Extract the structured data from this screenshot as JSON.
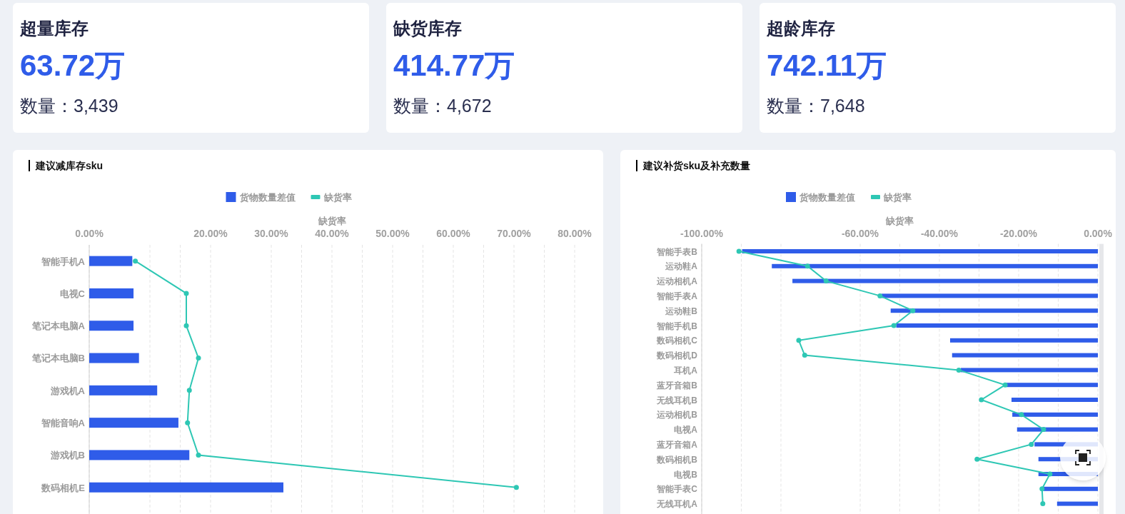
{
  "stats": [
    {
      "title": "超量库存",
      "value": "63.72万",
      "count": "数量：3,439"
    },
    {
      "title": "缺货库存",
      "value": "414.77万",
      "count": "数量：4,672"
    },
    {
      "title": "超龄库存",
      "value": "742.11万",
      "count": "数量：7,648"
    }
  ],
  "panels": [
    {
      "title": "建议减库存sku",
      "chart_data": {
        "type": "bar",
        "orientation": "horizontal",
        "xlabel": "缺货率",
        "xlim": [
          0,
          80
        ],
        "xticks": [
          {
            "value": 0,
            "label": "0.00%"
          },
          {
            "value": 20,
            "label": "20.00%"
          },
          {
            "value": 30,
            "label": "30.00%"
          },
          {
            "value": 40,
            "label": "40.00%"
          },
          {
            "value": 50,
            "label": "50.00%"
          },
          {
            "value": 60,
            "label": "60.00%"
          },
          {
            "value": 70,
            "label": "70.00%"
          },
          {
            "value": 80,
            "label": "80.00%"
          }
        ],
        "grid": true,
        "legend": true,
        "categories": [
          "智能手机A",
          "电视C",
          "笔记本电脑A",
          "笔记本电脑B",
          "游戏机A",
          "智能音响A",
          "游戏机B",
          "数码相机E"
        ],
        "stacked": false,
        "series": [
          {
            "name": "货物数量差值",
            "type": "bar",
            "color": "#2f5ce9",
            "values": [
              7.1,
              7.3,
              7.3,
              8.2,
              11.2,
              14.7,
              16.5,
              32
            ]
          },
          {
            "name": "缺货率",
            "type": "line",
            "marker": "circle",
            "color": "#2ec7b4",
            "values": [
              7.6,
              16,
              16,
              18,
              16.5,
              16.2,
              18,
              70.4
            ]
          }
        ]
      }
    },
    {
      "title": "建议补货sku及补充数量",
      "chart_data": {
        "type": "bar",
        "orientation": "horizontal",
        "xlabel": "缺货率",
        "xlim": [
          -100,
          0
        ],
        "xticks": [
          {
            "value": -100,
            "label": "-100.00%"
          },
          {
            "value": -60,
            "label": "-60.00%"
          },
          {
            "value": -40,
            "label": "-40.00%"
          },
          {
            "value": -20,
            "label": "-20.00%"
          },
          {
            "value": 0,
            "label": "0.00%"
          }
        ],
        "grid": true,
        "legend": true,
        "categories": [
          "智能手表B",
          "运动鞋A",
          "运动相机A",
          "智能手表A",
          "运动鞋B",
          "智能手机B",
          "数码相机C",
          "数码相机D",
          "耳机A",
          "蓝牙音箱B",
          "无线耳机B",
          "运动相机B",
          "电视A",
          "蓝牙音箱A",
          "数码相机B",
          "电视B",
          "智能手表C",
          "无线耳机A"
        ],
        "stacked": false,
        "series": [
          {
            "name": "货物数量差值",
            "type": "bar",
            "color": "#2f5ce9",
            "values": [
              -89.8,
              -82.3,
              -77.1,
              -54.6,
              -52.3,
              -50.9,
              -37.3,
              -36.8,
              -34.6,
              -23.1,
              -21.8,
              -21.6,
              -20.4,
              -16,
              -15,
              -15,
              -13.7,
              -10.3
            ]
          },
          {
            "name": "缺货率",
            "type": "line",
            "marker": "circle",
            "color": "#2ec7b4",
            "values": [
              -90.6,
              -73.3,
              -68.6,
              -55,
              -46.7,
              -51.5,
              -75.5,
              -74,
              -35.1,
              -23.4,
              -29.4,
              -19.3,
              -13.7,
              -16.8,
              -30.5,
              -12.1,
              -14.1,
              -13.9
            ]
          }
        ]
      }
    }
  ]
}
